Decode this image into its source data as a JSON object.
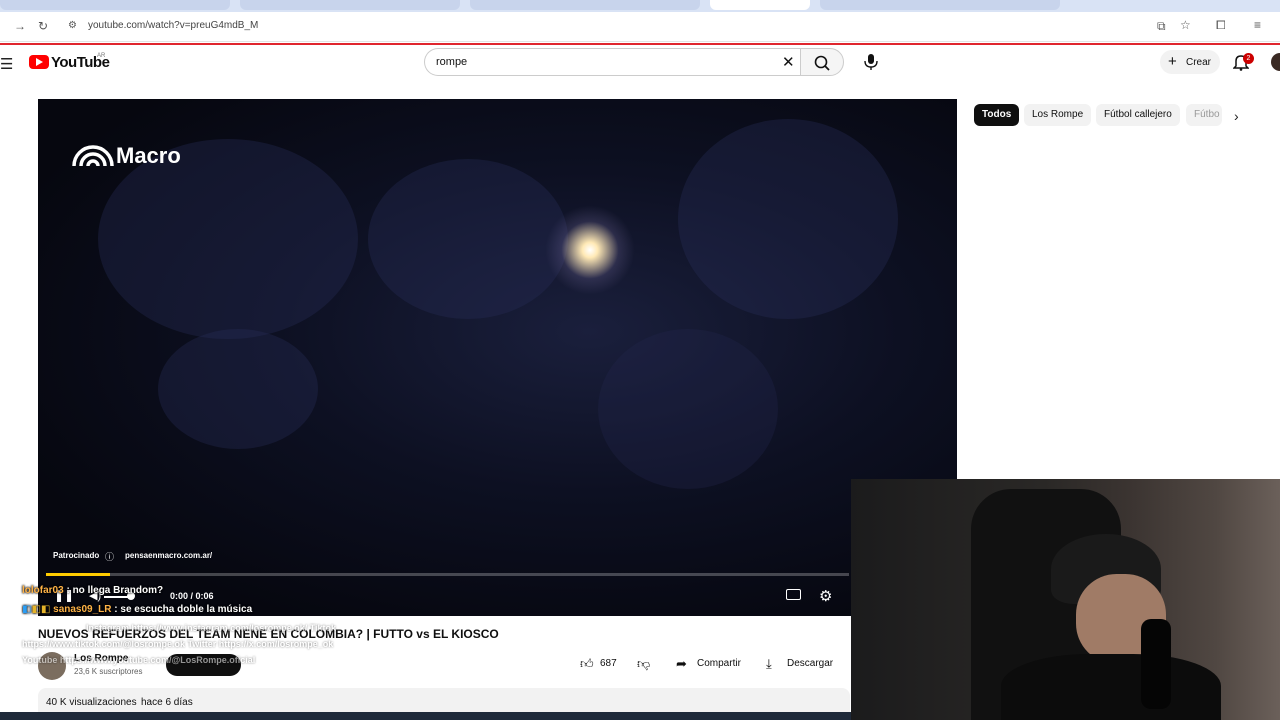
{
  "browser": {
    "url": "youtube.com/watch?v=preuG4mdB_M"
  },
  "header": {
    "logo": "YouTube",
    "country": "AR",
    "search_value": "rompe",
    "create_label": "Crear",
    "notifications_count": "2"
  },
  "player": {
    "brand": "Macro",
    "sponsored_label": "Patrocinado",
    "sponsor_url": "pensaenmacro.com.ar/",
    "time": "0:00 / 0:06",
    "progress_fraction": 0.08
  },
  "chips": [
    "Todos",
    "Los Rompe",
    "Fútbol callejero",
    "Fútbo"
  ],
  "video": {
    "title": "NUEVOS REFUERZOS DEL TEAM NENE EN COLOMBIA? | FUTTO vs EL KIOSCO",
    "channel": "Los Rompe",
    "subscribers": "23,6 K suscriptores",
    "likes": "687",
    "share_label": "Compartir",
    "download_label": "Descargar",
    "views": "40 K visualizaciones",
    "date": "hace 6 días"
  },
  "chat": [
    {
      "user": "lolofar03",
      "text": " : no llega Brandom?"
    },
    {
      "user": "sanas09_LR",
      "text": " : se escucha doble la música"
    }
  ],
  "chat_ghost": [
    "Instagram https://www.instagram.com/losrompe.ok/ Tiktok",
    "https://www.tiktok.com/@losrompe.ok Twitter https://x.com/losrompe_ok",
    "Youtube https://www.youtube.com/@LosRompe.oficial"
  ]
}
